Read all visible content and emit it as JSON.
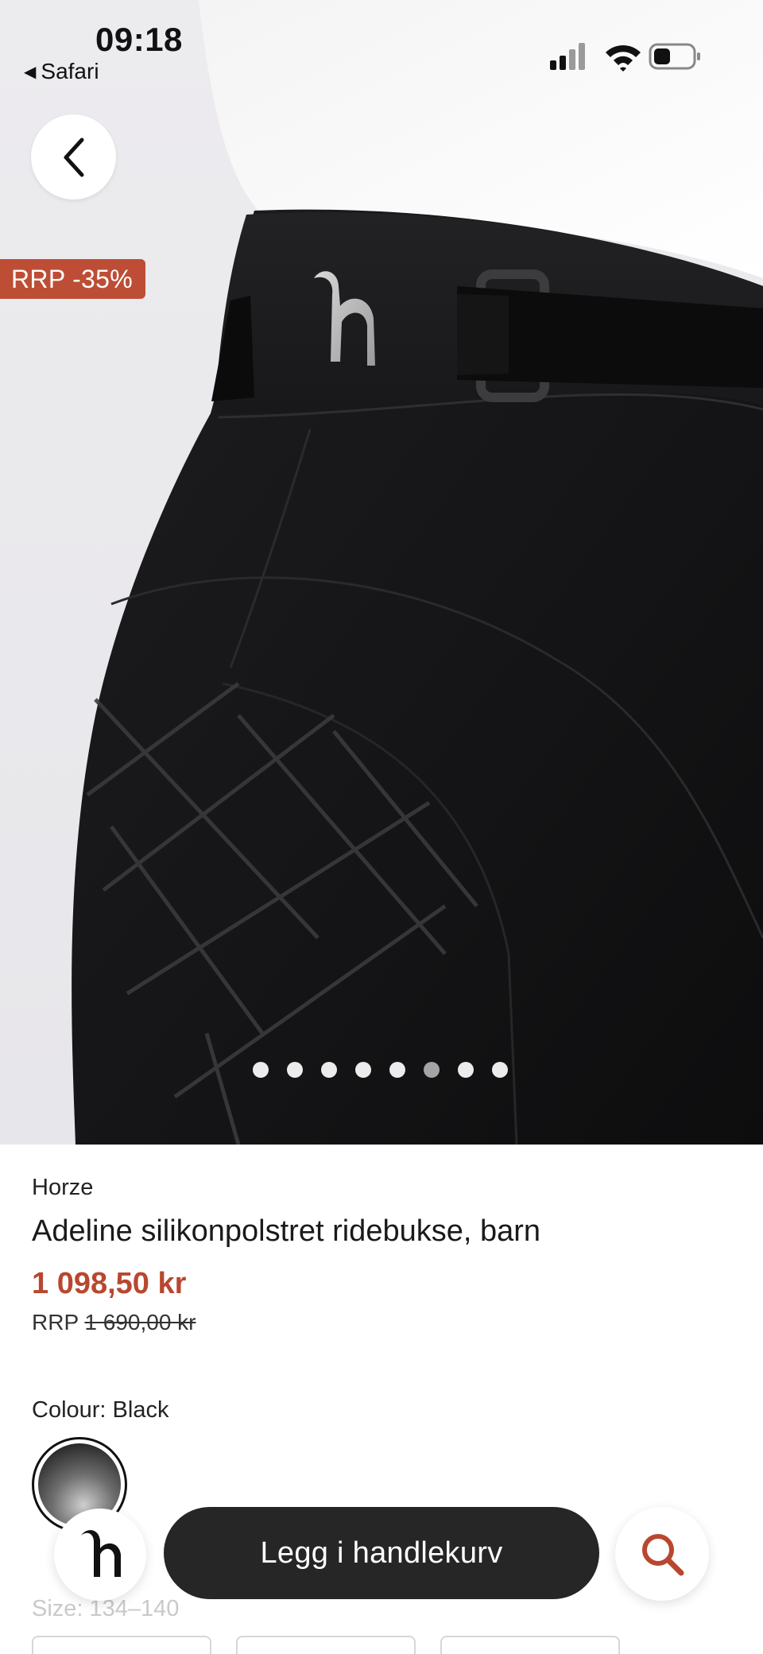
{
  "status_bar": {
    "time": "09:18",
    "back_app": "Safari"
  },
  "hero": {
    "discount_badge": "RRP -35%",
    "carousel": {
      "total": 8,
      "active_index": 5
    }
  },
  "product": {
    "brand": "Horze",
    "title": "Adeline silikonpolstret ridebukse, barn",
    "price": "1 098,50 kr",
    "rrp_label": "RRP",
    "rrp_price": "1 690,00 kr",
    "colour_label": "Colour: Black",
    "size_label": "Size: 134–140"
  },
  "bottom_bar": {
    "cart_button": "Legg i handlekurv"
  },
  "colors": {
    "accent": "#bd4e35",
    "price": "#b8472f",
    "cart_button_bg": "#262626"
  },
  "icons": {
    "back": "chevron-left-icon",
    "home": "horze-logo-icon",
    "search": "search-icon"
  }
}
